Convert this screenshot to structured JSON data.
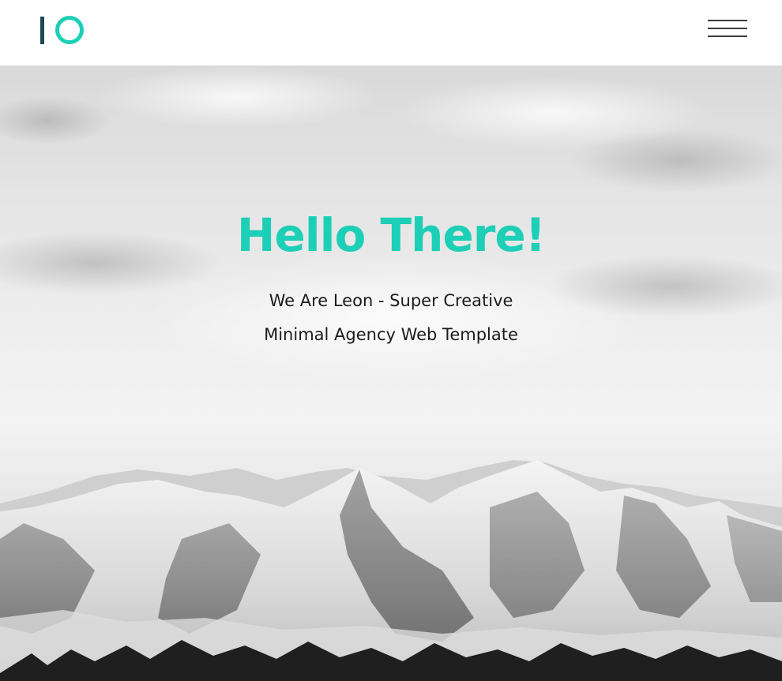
{
  "header": {
    "logo_icon": "io-logo-icon",
    "menu_icon": "hamburger-menu-icon"
  },
  "hero": {
    "title": "Hello There!",
    "subtitle_line1": "We Are Leon - Super Creative",
    "subtitle_line2": "Minimal Agency Web Template",
    "background": "snowy-mountains-image"
  },
  "colors": {
    "accent": "#1ccfb6",
    "logo_dark": "#1e4a55",
    "text": "#1b1b1b"
  }
}
